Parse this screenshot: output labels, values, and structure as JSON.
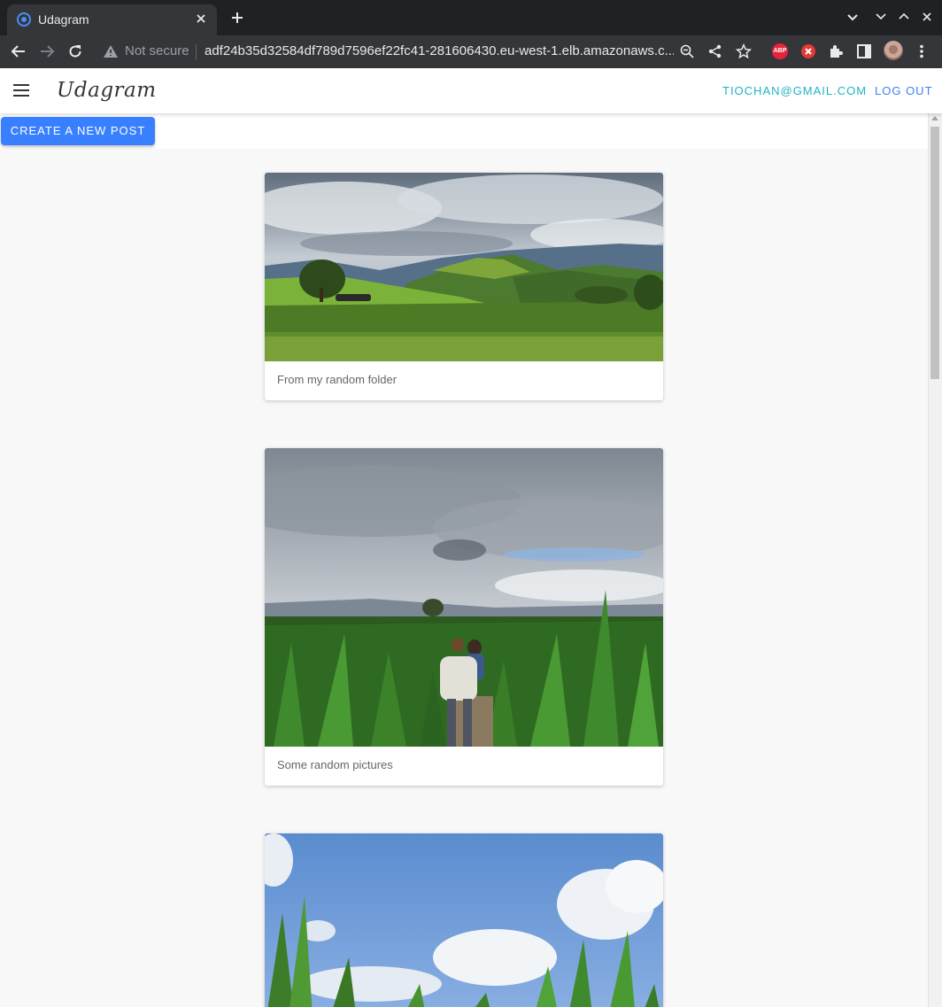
{
  "browser": {
    "tab_title": "Udagram",
    "security_label": "Not secure",
    "url": "adf24b35d32584df789d7596ef22fc41-281606430.eu-west-1.elb.amazonaws.c...",
    "extension_abp_label": "ABP"
  },
  "app": {
    "brand": "Udagram",
    "user_email": "TIOCHAN@GMAIL.COM",
    "logout_label": "LOG OUT",
    "create_post_label": "CREATE A NEW POST"
  },
  "feed": {
    "posts": [
      {
        "image": "green hills landscape under cloudy sky",
        "caption": "From my random folder"
      },
      {
        "image": "two people walking through a cornfield",
        "caption": "Some random pictures"
      },
      {
        "image": "corn leaves against blue sky with clouds",
        "caption": ""
      }
    ]
  },
  "colors": {
    "accent": "#3880ff",
    "email_link": "#1fb3c4",
    "logout_link": "#3d7ff0",
    "chrome_dark": "#202124"
  }
}
